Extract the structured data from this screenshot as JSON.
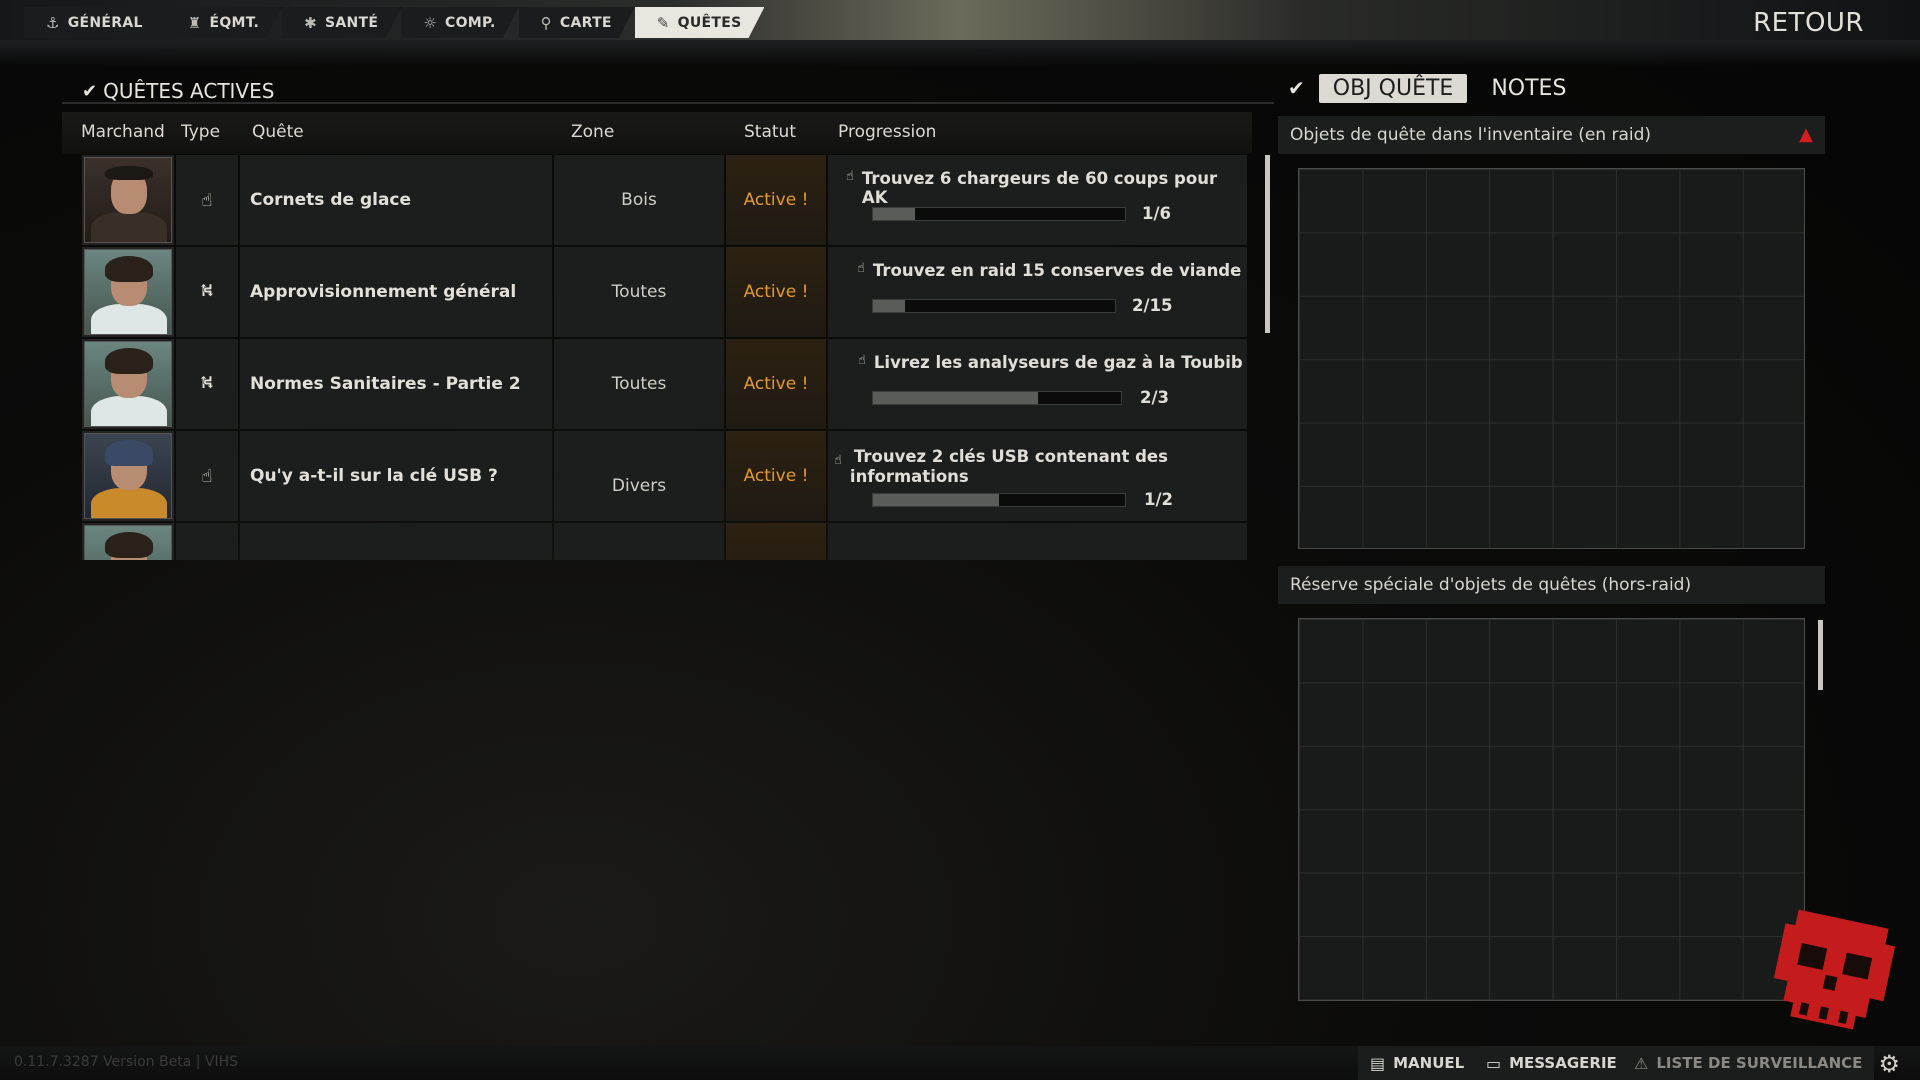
{
  "nav": {
    "tabs": [
      {
        "label": "GÉNÉRAL",
        "icon": "anchor-icon",
        "glyph": "⚓"
      },
      {
        "label": "ÉQMT.",
        "icon": "gear-figure-icon",
        "glyph": "♜"
      },
      {
        "label": "SANTÉ",
        "icon": "health-icon",
        "glyph": "✱"
      },
      {
        "label": "COMP.",
        "icon": "skills-icon",
        "glyph": "☼"
      },
      {
        "label": "CARTE",
        "icon": "map-pin-icon",
        "glyph": "⚲"
      },
      {
        "label": "QUÊTES",
        "icon": "quest-icon",
        "glyph": "✎"
      }
    ],
    "active_index": 5,
    "back_label": "RETOUR"
  },
  "quests_panel": {
    "title": "QUÊTES ACTIVES",
    "columns": {
      "trader": "Marchand",
      "type": "Type",
      "quest": "Quête",
      "zone": "Zone",
      "status": "Statut",
      "progress": "Progression"
    },
    "rows": [
      {
        "trader_icon": "trader-prapor",
        "type_icon": "hand-icon",
        "type_glyph": "☝",
        "quest": "Cornets de glace",
        "zone": "Bois",
        "status": "Active !",
        "objective": "Trouvez 6 chargeurs de 60 coups pour AK",
        "objective_line2": "",
        "progress_text": "1/6",
        "progress": 0.1667
      },
      {
        "trader_icon": "trader-therapist",
        "type_icon": "exit-icon",
        "type_glyph": "⛕",
        "quest": "Approvisionnement général",
        "zone": "Toutes",
        "status": "Active !",
        "objective": "Trouvez en raid 15 conserves de viande",
        "objective_line2": "",
        "progress_text": "2/15",
        "progress": 0.1333
      },
      {
        "trader_icon": "trader-therapist",
        "type_icon": "exit-icon",
        "type_glyph": "⛕",
        "quest": "Normes Sanitaires - Partie 2",
        "zone": "Toutes",
        "status": "Active !",
        "objective": "Livrez les analyseurs de gaz à la Toubib",
        "objective_line2": "",
        "progress_text": "2/3",
        "progress": 0.6667
      },
      {
        "trader_icon": "trader-mechanic",
        "type_icon": "hand-icon",
        "type_glyph": "☝",
        "quest": "Qu'y a-t-il sur la clé USB ?",
        "zone": "Divers",
        "status": "Active !",
        "objective": "Trouvez 2 clés USB contenant des",
        "objective_line2": "informations",
        "progress_text": "1/2",
        "progress": 0.5
      }
    ]
  },
  "side_panel": {
    "tabs": [
      "OBJ QUÊTE",
      "NOTES"
    ],
    "active_tab": 0,
    "inventory_title": "Objets de quête dans l'inventaire (en raid)",
    "reserve_title": "Réserve spéciale d'objets de quêtes (hors-raid)"
  },
  "bottom": {
    "version": "0.11.7.3287 Version Beta | VIHS",
    "buttons": [
      {
        "label": "MANUEL",
        "icon": "manual-icon",
        "glyph": "▤"
      },
      {
        "label": "MESSAGERIE",
        "icon": "chat-icon",
        "glyph": "▭"
      },
      {
        "label": "LISTE DE SURVEILLANCE",
        "icon": "warning-icon",
        "glyph": "⚠"
      }
    ]
  },
  "colors": {
    "status": "#e39a2b",
    "warning": "#d21f1f",
    "logo": "#c41c1c"
  }
}
